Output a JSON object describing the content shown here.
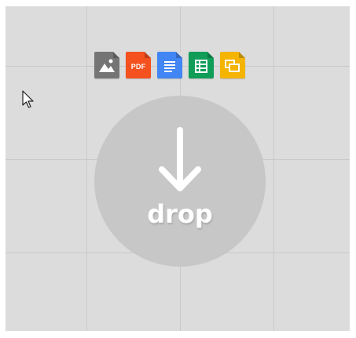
{
  "dropzone": {
    "label": "drop",
    "background": "#dcdcdc",
    "circle_color": "#c7c7c7"
  },
  "file_types": [
    {
      "icon": "image-file-icon",
      "color": "#757575"
    },
    {
      "icon": "pdf-file-icon",
      "color": "#f4511e",
      "text": "PDF"
    },
    {
      "icon": "docs-file-icon",
      "color": "#4285f4"
    },
    {
      "icon": "sheets-file-icon",
      "color": "#0f9d58"
    },
    {
      "icon": "slides-file-icon",
      "color": "#f4b400"
    }
  ],
  "cursor": {
    "icon": "mouse-pointer-icon"
  }
}
